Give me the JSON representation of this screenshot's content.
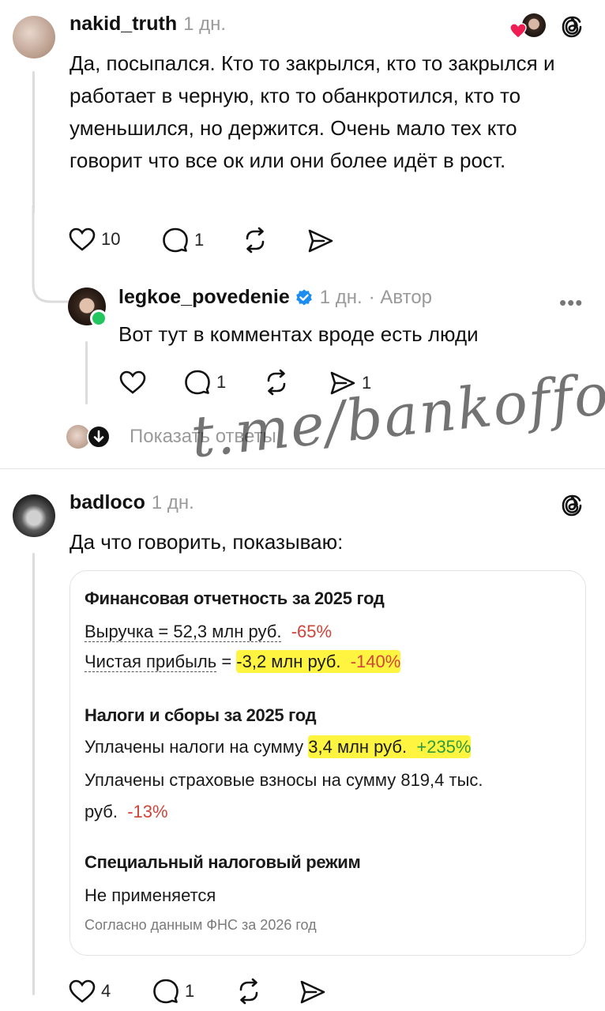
{
  "comment1": {
    "username": "nakid_truth",
    "time": "1 дн.",
    "text": "Да, посыпался. Кто то закрылся, кто то закрылся и работает в черную, кто то обанкротился, кто то уменьшился, но держится. Очень мало тех кто говорит что все ок или они более идёт в рост.",
    "likes": "10",
    "replies": "1"
  },
  "reply1": {
    "username": "legkoe_povedenie",
    "time": "1 дн.",
    "author_label": "· Автор",
    "text": "Вот тут в комментах вроде есть люди",
    "replies": "1",
    "shares": "1"
  },
  "show_replies": "Показать ответы",
  "watermark": "t.me/bankoffo",
  "comment2": {
    "username": "badloco",
    "time": "1 дн.",
    "text": "Да что говорить, показываю:",
    "likes": "4",
    "replies": "1"
  },
  "card": {
    "section1_title": "Финансовая отчетность за 2025 год",
    "revenue_label": "Выручка = 52,3 млн руб.",
    "revenue_change": "-65%",
    "profit_label": "Чистая прибыль",
    "profit_eq": " = ",
    "profit_value": "-3,2 млн руб.",
    "profit_change": "-140%",
    "section2_title": "Налоги и сборы за 2025 год",
    "taxes_label": "Уплачены налоги на сумму ",
    "taxes_value": "3,4 млн руб.",
    "taxes_change": "+235%",
    "insurance_line1": "Уплачены страховые взносы на сумму 819,4 тыс.",
    "insurance_line2": "руб.",
    "insurance_change": "-13%",
    "section3_title": "Специальный налоговый режим",
    "regime_value": "Не применяется",
    "source": "Согласно данным ФНС за 2026 год"
  },
  "colors": {
    "red": "#d0443a",
    "green": "#2e9a3d",
    "highlight": "#fff000",
    "verified": "#1d8cf0",
    "online": "#22c55e"
  }
}
